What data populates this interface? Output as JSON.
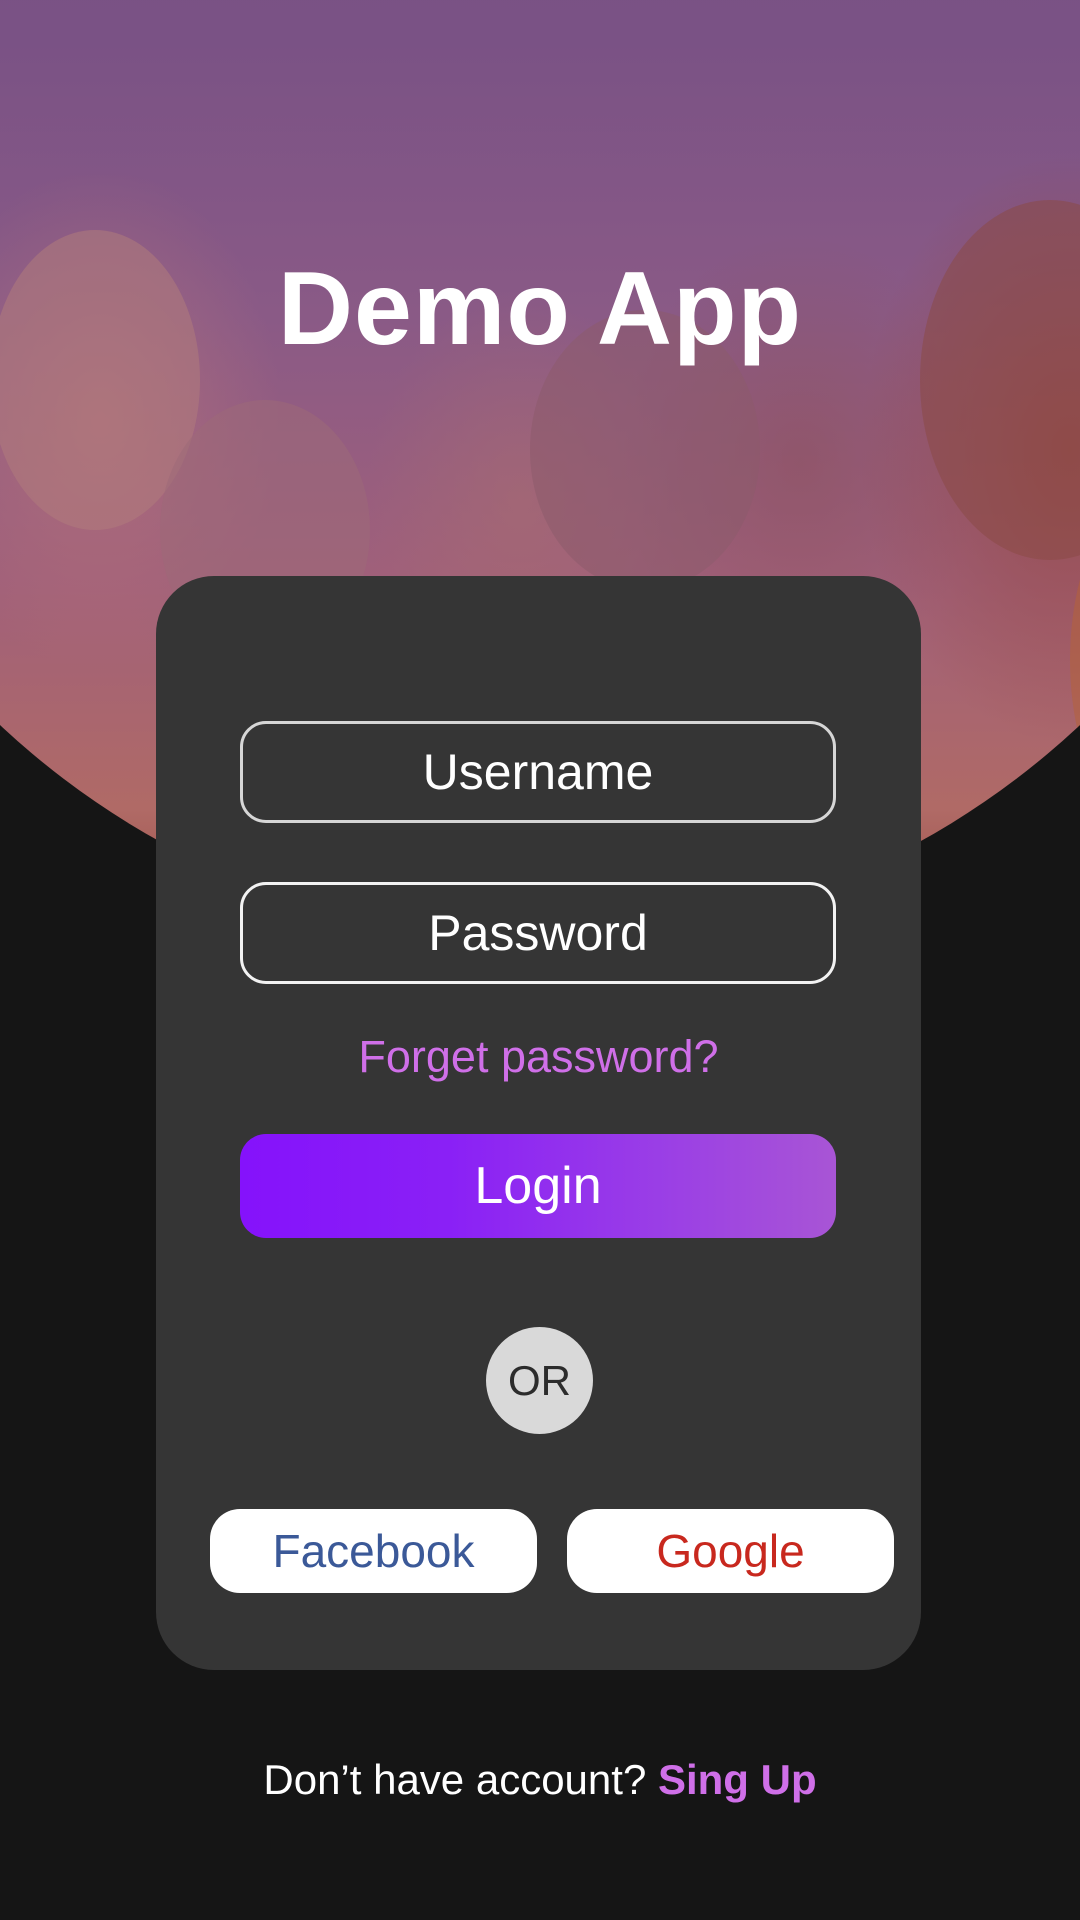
{
  "app": {
    "title": "Demo App"
  },
  "login_form": {
    "username_placeholder": "Username",
    "password_placeholder": "Password",
    "forgot_password_label": "Forget password?",
    "login_label": "Login",
    "divider_label": "OR"
  },
  "social": {
    "facebook_label": "Facebook",
    "google_label": "Google"
  },
  "footer": {
    "prompt_text": "Don’t have account?",
    "signup_label": "Sing Up"
  },
  "colors": {
    "background": "#151515",
    "card": "#353535",
    "accent": "#cf6fe8",
    "login_gradient_start": "#8512fb",
    "login_gradient_end": "#a855d5",
    "facebook": "#3b5998",
    "google": "#c8281e"
  },
  "background_image": "photo of group of friends laughing outdoors with purple overlay"
}
